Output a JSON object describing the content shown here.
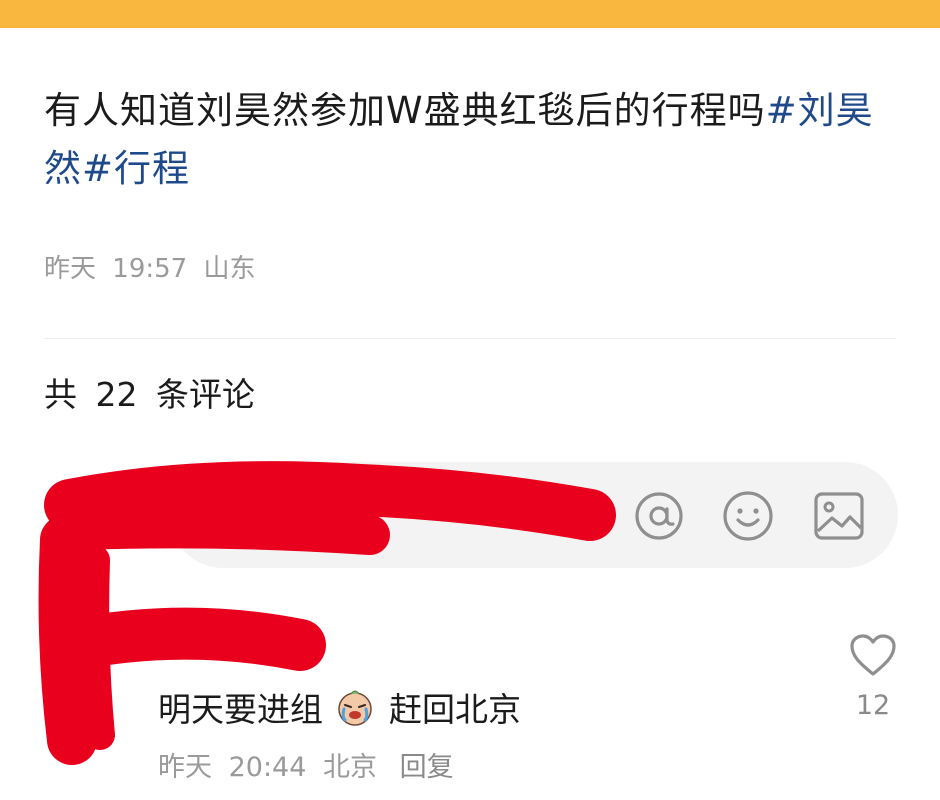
{
  "post": {
    "text": "有人知道刘昊然参加W盛典红毯后的行程吗",
    "hashtags": [
      "#刘昊然#",
      "行程"
    ],
    "date": "昨天",
    "time": "19:57",
    "location": "山东"
  },
  "comments_header": {
    "prefix": "共",
    "count": "22",
    "suffix": "条评论"
  },
  "comment_input": {
    "icons": [
      "at-icon",
      "emoji-icon",
      "image-icon"
    ]
  },
  "comments": [
    {
      "text_before": "明天要进组",
      "emoji": "crying-emoji",
      "text_after": "赶回北京",
      "date": "昨天",
      "time": "20:44",
      "location": "北京",
      "reply_label": "回复",
      "likes": "12"
    }
  ],
  "colors": {
    "top_bar": "#f9b73f",
    "hashtag": "#1f4a8a",
    "redaction": "#e8001c"
  }
}
